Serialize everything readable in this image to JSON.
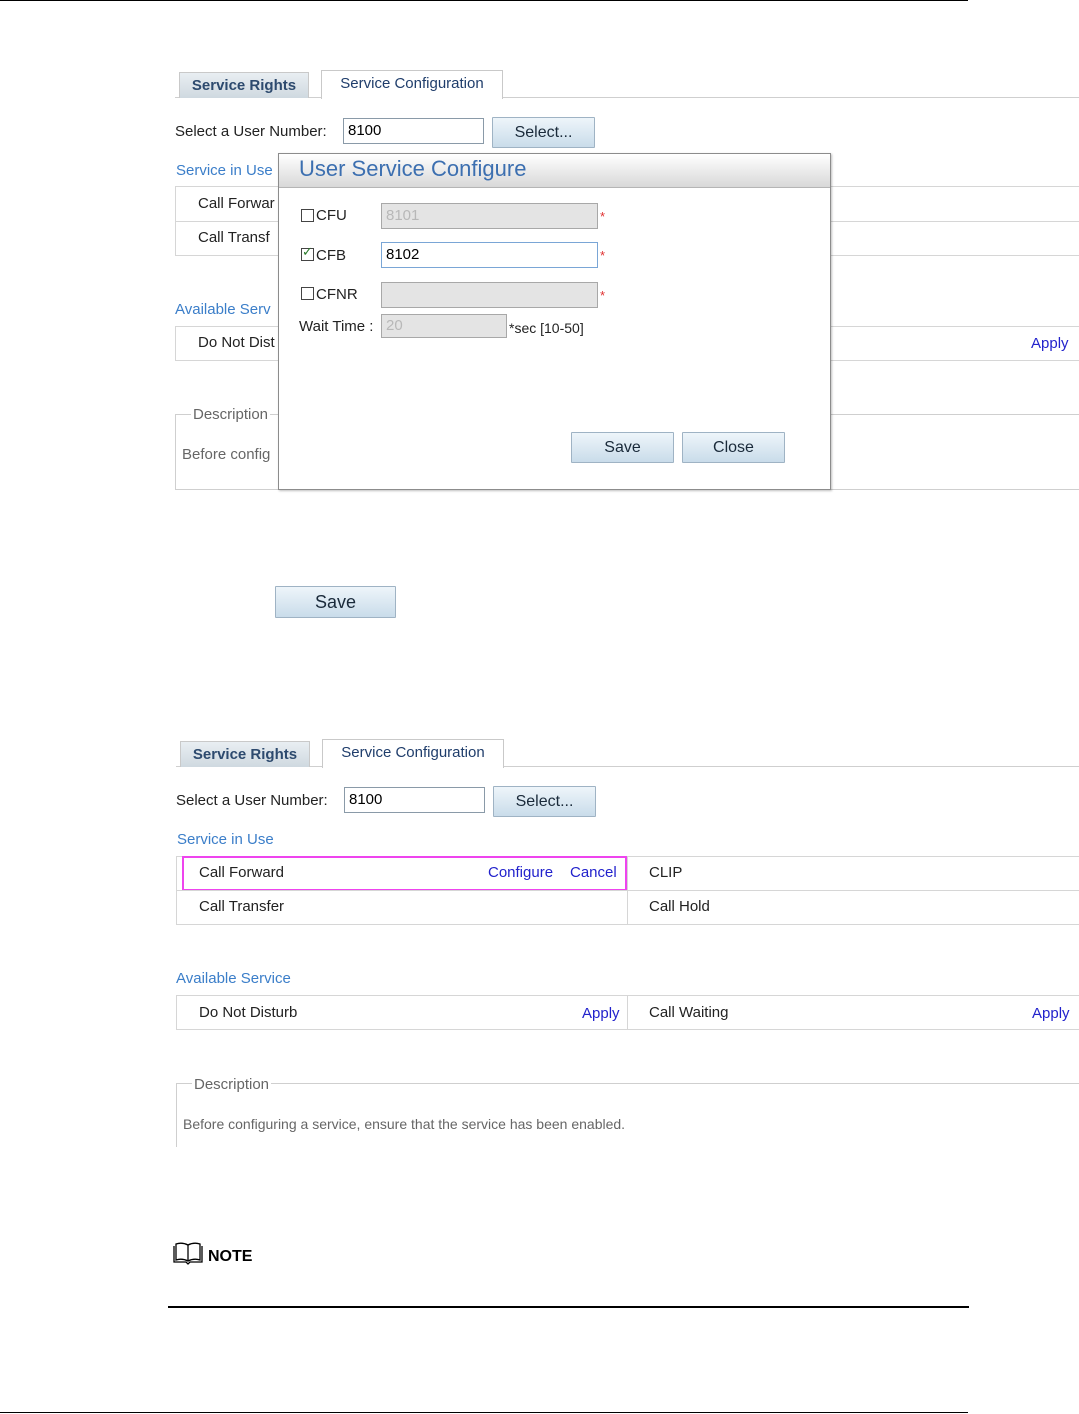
{
  "top_shot": {
    "tabs": [
      "Service Rights",
      "Service Configuration"
    ],
    "user_number_label": "Select a User Number:",
    "user_number_value": "8100",
    "select_button": "Select...",
    "service_in_use_title": "Service in Use",
    "in_use_rows": [
      "Call Forwar",
      "Call Transf"
    ],
    "available_title": "Available Serv",
    "available_rows": [
      "Do Not Dist"
    ],
    "apply_link": "Apply",
    "description_legend": "Description",
    "description_text": "Before config",
    "save_button": "Save",
    "dialog": {
      "title": "User Service Configure",
      "cfu_label": "CFU",
      "cfu_value": "8101",
      "cfu_checked": false,
      "cfb_label": "CFB",
      "cfb_value": "8102",
      "cfb_checked": true,
      "cfnr_label": "CFNR",
      "cfnr_value": "",
      "cfnr_checked": false,
      "required_mark": "*",
      "wait_time_label": "Wait Time :",
      "wait_time_value": "20",
      "wait_time_hint": "*sec [10-50]",
      "save_button": "Save",
      "close_button": "Close"
    }
  },
  "bottom_shot": {
    "tabs": [
      "Service Rights",
      "Service Configuration"
    ],
    "user_number_label": "Select a User Number:",
    "user_number_value": "8100",
    "select_button": "Select...",
    "service_in_use_title": "Service in Use",
    "in_use": {
      "left": [
        {
          "name": "Call Forward",
          "configure": "Configure",
          "cancel": "Cancel"
        },
        {
          "name": "Call Transfer"
        }
      ],
      "right": [
        "CLIP",
        "Call Hold"
      ]
    },
    "available_title": "Available Service",
    "available": [
      {
        "name": "Do Not Disturb",
        "action": "Apply"
      },
      {
        "name": "Call Waiting",
        "action": "Apply"
      }
    ],
    "description_legend": "Description",
    "description_text": "Before configuring a service, ensure that the service has been enabled."
  },
  "note_label": "NOTE",
  "colors": {
    "section_title": "#3b7ec9",
    "link": "#2222cc",
    "highlight": "#ee44ee",
    "dialog_title": "#3c6fb0",
    "required": "#e03030"
  },
  "icons": [
    "book-icon",
    "checkbox-icon"
  ]
}
